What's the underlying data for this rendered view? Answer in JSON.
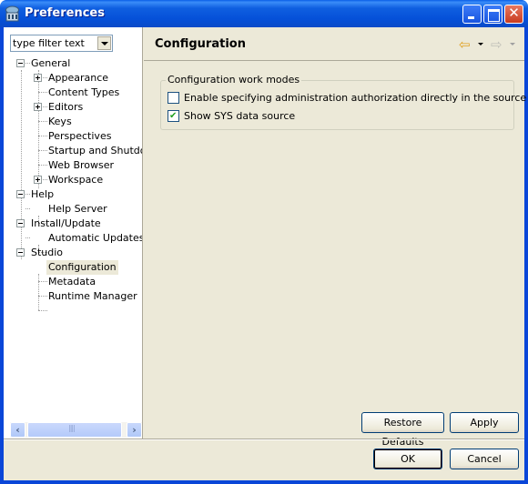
{
  "window": {
    "title": "Preferences"
  },
  "filter": {
    "placeholder": "type filter text",
    "value": "type filter text"
  },
  "tree": [
    {
      "label": "General",
      "expander": "minus",
      "level": 0
    },
    {
      "label": "Appearance",
      "expander": "plus",
      "level": 1
    },
    {
      "label": "Content Types",
      "expander": null,
      "level": 1
    },
    {
      "label": "Editors",
      "expander": "plus",
      "level": 1
    },
    {
      "label": "Keys",
      "expander": null,
      "level": 1
    },
    {
      "label": "Perspectives",
      "expander": null,
      "level": 1
    },
    {
      "label": "Startup and Shutdown",
      "expander": null,
      "level": 1
    },
    {
      "label": "Web Browser",
      "expander": null,
      "level": 1
    },
    {
      "label": "Workspace",
      "expander": "plus",
      "level": 1
    },
    {
      "label": "Help",
      "expander": "minus",
      "level": 0
    },
    {
      "label": "Help Server",
      "expander": null,
      "level": 1
    },
    {
      "label": "Install/Update",
      "expander": "minus",
      "level": 0
    },
    {
      "label": "Automatic Updates",
      "expander": null,
      "level": 1
    },
    {
      "label": "Studio",
      "expander": "minus",
      "level": 0
    },
    {
      "label": "Configuration",
      "expander": null,
      "level": 1,
      "selected": true
    },
    {
      "label": "Metadata",
      "expander": null,
      "level": 1
    },
    {
      "label": "Runtime Manager",
      "expander": null,
      "level": 1
    }
  ],
  "page": {
    "title": "Configuration",
    "group_label": "Configuration work modes",
    "options": [
      {
        "label": "Enable specifying administration authorization directly in the source XML",
        "checked": false
      },
      {
        "label": "Show SYS data source",
        "checked": true
      }
    ]
  },
  "buttons": {
    "restore_defaults": "Restore Defaults",
    "apply": "Apply",
    "ok": "OK",
    "cancel": "Cancel"
  },
  "icons": {
    "back": "⇦",
    "forward": "⇨",
    "close": "✕",
    "scroll_left": "‹",
    "scroll_right": "›"
  }
}
